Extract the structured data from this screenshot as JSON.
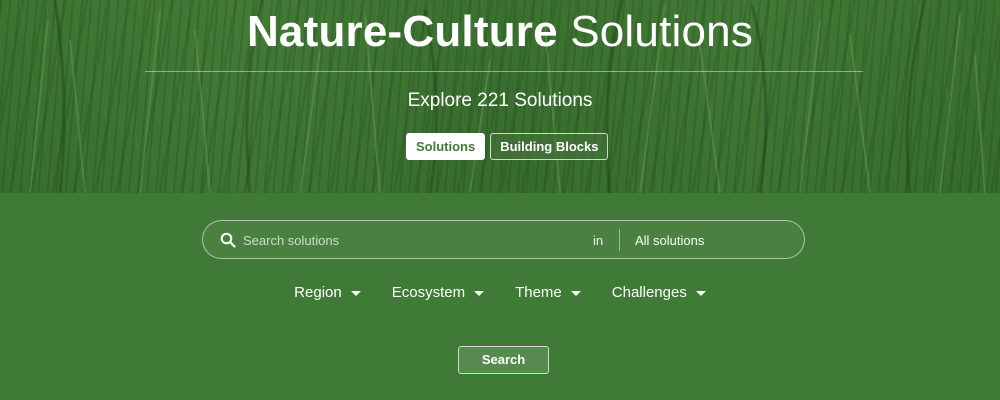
{
  "hero": {
    "title_bold": "Nature-Culture",
    "title_light": "Solutions",
    "subtitle": "Explore 221 Solutions",
    "tabs": [
      {
        "label": "Solutions",
        "active": true
      },
      {
        "label": "Building Blocks",
        "active": false
      }
    ]
  },
  "search": {
    "icon": "search-icon",
    "placeholder": "Search solutions",
    "value": "",
    "in_label": "in",
    "scope_label": "All solutions"
  },
  "filters": [
    {
      "label": "Region",
      "icon": "caret-down-icon"
    },
    {
      "label": "Ecosystem",
      "icon": "caret-down-icon"
    },
    {
      "label": "Theme",
      "icon": "caret-down-icon"
    },
    {
      "label": "Challenges",
      "icon": "caret-down-icon"
    }
  ],
  "submit_label": "Search",
  "colors": {
    "brand_green": "#3f7a36",
    "text": "#ffffff"
  }
}
